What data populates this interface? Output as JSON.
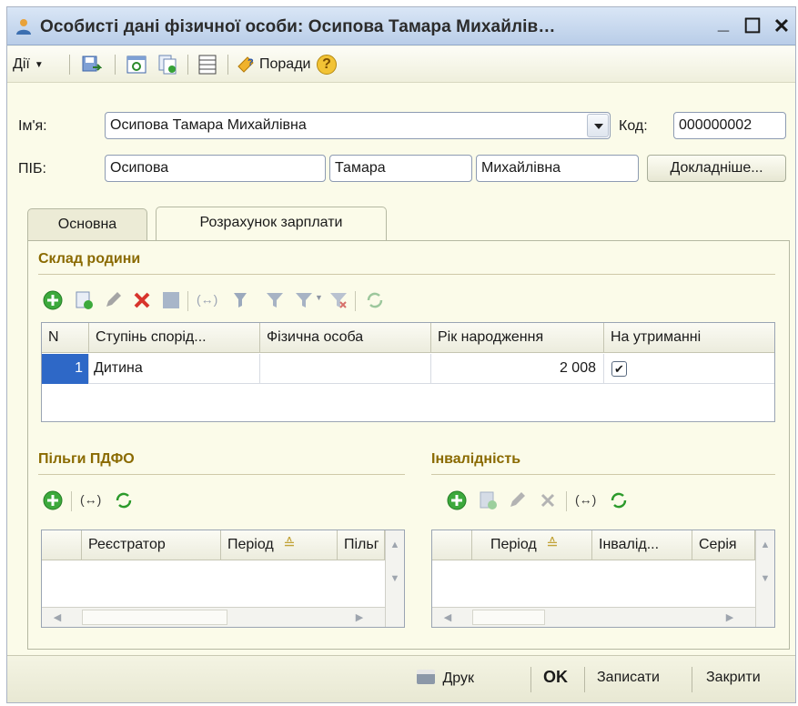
{
  "window": {
    "title": "Особисті дані фізичної особи: Осипова Тамара Михайлів…",
    "minimize": "_",
    "maximize": "☐",
    "close": "✕"
  },
  "toolbar": {
    "actions_label": "Дії",
    "tips_label": "Поради",
    "help": "?"
  },
  "form": {
    "name_label": "Ім'я:",
    "name_value": "Осипова Тамара Михайлівна",
    "code_label": "Код:",
    "code_value": "000000002",
    "pib_label": "ПІБ:",
    "last_name": "Осипова",
    "first_name": "Тамара",
    "middle_name": "Михайлівна",
    "details_button": "Докладніше..."
  },
  "tabs": [
    {
      "label": "Основна",
      "active": false
    },
    {
      "label": "Розрахунок зарплати",
      "active": true
    }
  ],
  "family": {
    "title": "Склад родини",
    "columns": [
      "N",
      "Ступінь спорід...",
      "Фізична особа",
      "Рік народження",
      "На утриманні"
    ],
    "rows": [
      {
        "n": "1",
        "relation": "Дитина",
        "person": "",
        "birth_year": "2 008",
        "dependent": true
      }
    ]
  },
  "tax_benefits": {
    "title": "Пільги ПДФО",
    "columns": [
      "Реєстратор",
      "Період",
      "Пільг"
    ]
  },
  "disability": {
    "title": "Інвалідність",
    "columns": [
      "Період",
      "Інвалід...",
      "Серія"
    ]
  },
  "bottom": {
    "print": "Друк",
    "ok": "OK",
    "save": "Записати",
    "close": "Закрити"
  },
  "colors": {
    "section_title": "#8a6a00",
    "window_bg": "#fbfbe9",
    "titlebar": "#c8d9ef"
  }
}
